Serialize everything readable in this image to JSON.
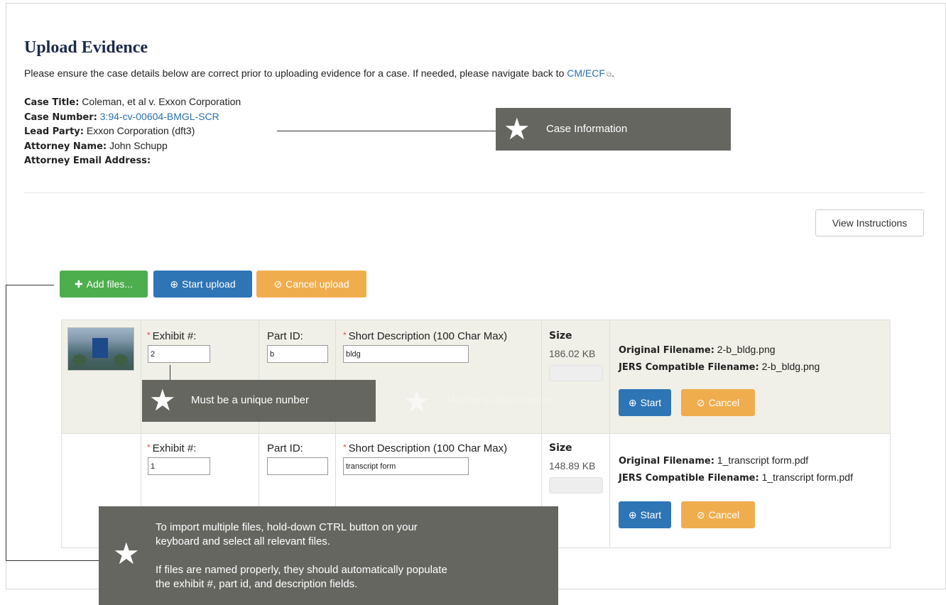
{
  "page": {
    "title": "Upload Evidence",
    "notice": "Please ensure the case details below are correct prior to uploading evidence for a case. If needed, please navigate back to ",
    "notice_link": "CM/ECF",
    "notice_end": "."
  },
  "case": {
    "title_label": "Case Title:",
    "title_value": "Coleman, et al v. Exxon Corporation",
    "number_label": "Case Number:",
    "number_value": "3:94-cv-00604-BMGL-SCR",
    "lead_label": "Lead Party:",
    "lead_value": "Exxon Corporation (dft3)",
    "attorney_label": "Attorney Name:",
    "attorney_value": "John Schupp",
    "email_label": "Attorney Email Address:",
    "email_value": ""
  },
  "toolbar": {
    "view_instructions": "View Instructions",
    "add_files": "Add files...",
    "start_upload": "Start upload",
    "cancel_upload": "Cancel upload"
  },
  "labels": {
    "exhibit": "Exhibit #:",
    "part_id": "Part ID:",
    "short_desc": "Short Description (100 Char Max)",
    "size": "Size",
    "original": "Original Filename:",
    "jers": "JERS Compatible Filename:",
    "start": "Start",
    "cancel": "Cancel",
    "required_mark": "*"
  },
  "files": [
    {
      "exhibit": "2",
      "part_id": "b",
      "description": "bldg",
      "size": "186.02 KB",
      "progress": 0,
      "original": "2-b_bldg.png",
      "jers": "2-b_bldg.png"
    },
    {
      "exhibit": "1",
      "part_id": "",
      "description": "transcript form",
      "size": "148.89 KB",
      "progress": 0,
      "original": "1_transcript form.pdf",
      "jers": "1_transcript form.pdf"
    }
  ],
  "callouts": {
    "case_info": "Case Information",
    "unique": "Must be a unique nunber",
    "ghost": "Must be a unique number",
    "multi_line1": "To import multiple files, hold-down CTRL button on your",
    "multi_line2": "keyboard and select all relevant files.",
    "multi_line3": "If files are named properly, they should automatically populate",
    "multi_line4": "the exhibit #, part id, and description fields."
  },
  "icons": {
    "star": "★",
    "plus": "✚",
    "upload": "⊕",
    "cancel": "⊘",
    "external": "⧉"
  },
  "colors": {
    "success": "#4cae4c",
    "primary": "#2e75b6",
    "warning": "#f0ad4e",
    "callout": "#60605b",
    "title": "#1c2b4a",
    "link": "#2a6fb0"
  }
}
